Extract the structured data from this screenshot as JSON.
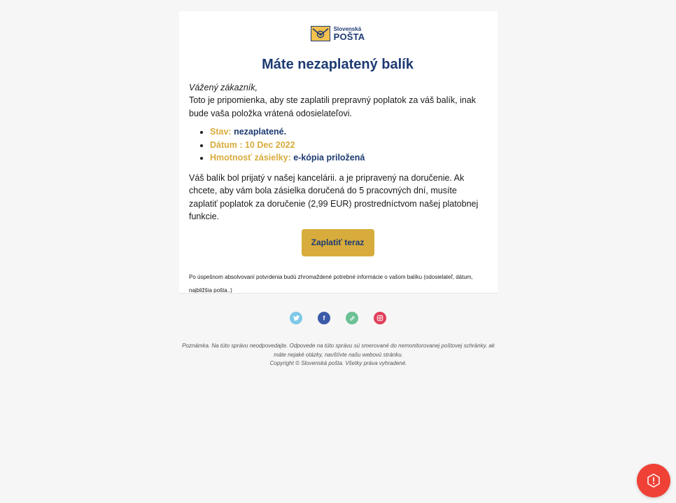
{
  "logo": {
    "line1": "Slovenská",
    "line2": "POŠTA"
  },
  "heading": "Máte nezaplatený balík",
  "greeting": "Vážený zákazník,",
  "intro": "Toto je pripomienka, aby ste zaplatili prepravný poplatok za váš balík, inak bude vaša položka vrátená odosielateľovi.",
  "details": [
    {
      "label": "Stav:",
      "value": "nezaplatené."
    },
    {
      "label": "Dátum : 10 Dec 2022",
      "value": ""
    },
    {
      "label": "Hmotnosť zásielky:",
      "value": "e-kópia priložená"
    }
  ],
  "body": "Váš balík bol prijatý v našej kancelárii. a je pripravený na doručenie. Ak chcete, aby vám bola zásielka doručená do 5 pracovných dní, musíte zaplatiť poplatok za doručenie (2,99 EUR) prostredníctvom našej platobnej funkcie.",
  "pay_button": "Zaplatiť teraz",
  "note": "Po úspešnom absolvovaní potvrdenia budú zhromaždené potrebné informácie o vašom balíku (odosielateľ, dátum, najbližšia pošta..)",
  "social": [
    {
      "name": "twitter-icon",
      "color": "#7ec8e8"
    },
    {
      "name": "facebook-icon",
      "color": "#3b5aa7"
    },
    {
      "name": "link-icon",
      "color": "#6cc195"
    },
    {
      "name": "instagram-icon",
      "color": "#df3f5a"
    }
  ],
  "footer": {
    "line1": "Poznámka. Na túto správu neodpovedajte. Odpovede na túto správu sú smerované do nemonitorovanej poštovej schránky. ak máte nejaké otázky, navštívte našu webovú stránku.",
    "line2": "Copyright © Slovenská pošta. Všetky práva vyhradené."
  },
  "colors": {
    "accent_gold": "#d8ac3c",
    "brand_navy": "#1d3a72",
    "alert_red": "#ef4136"
  }
}
